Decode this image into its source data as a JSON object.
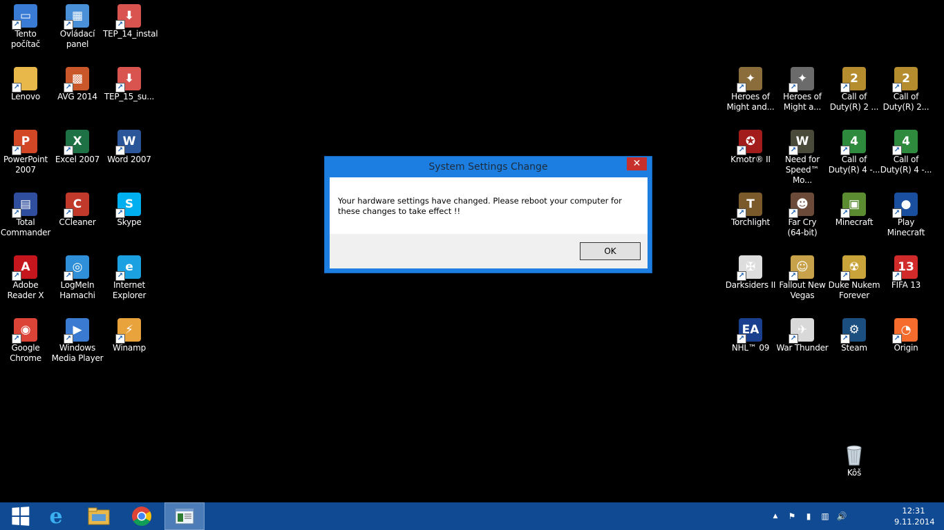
{
  "desktop": {
    "left_icons": [
      {
        "label": "Tento\npočítač",
        "icon": "computer-icon",
        "color": "#3a7bd5",
        "glyph": "▭"
      },
      {
        "label": "Ovládací\npanel",
        "icon": "control-panel-icon",
        "color": "#4a90d9",
        "glyph": "▦"
      },
      {
        "label": "TEP_14_instal",
        "icon": "installer-icon",
        "color": "#d9534f",
        "glyph": "⬇"
      },
      {
        "label": "Lenovo",
        "icon": "folder-icon",
        "color": "#e8b84a",
        "glyph": ""
      },
      {
        "label": "AVG 2014",
        "icon": "avg-icon",
        "color": "#c9572a",
        "glyph": "▩"
      },
      {
        "label": "TEP_15_su...",
        "icon": "installer-icon",
        "color": "#d9534f",
        "glyph": "⬇"
      },
      {
        "label": "PowerPoint\n2007",
        "icon": "powerpoint-icon",
        "color": "#d24726",
        "glyph": "P"
      },
      {
        "label": "Excel 2007",
        "icon": "excel-icon",
        "color": "#1e7145",
        "glyph": "X"
      },
      {
        "label": "Word 2007",
        "icon": "word-icon",
        "color": "#2b579a",
        "glyph": "W"
      },
      {
        "label": "Total\nCommander",
        "icon": "total-commander-icon",
        "color": "#2f4f9e",
        "glyph": "▤"
      },
      {
        "label": "CCleaner",
        "icon": "ccleaner-icon",
        "color": "#c0392b",
        "glyph": "C"
      },
      {
        "label": "Skype",
        "icon": "skype-icon",
        "color": "#00aff0",
        "glyph": "S"
      },
      {
        "label": "Adobe\nReader X",
        "icon": "adobe-reader-icon",
        "color": "#c4161c",
        "glyph": "A"
      },
      {
        "label": "LogMeIn\nHamachi",
        "icon": "hamachi-icon",
        "color": "#2f8fd8",
        "glyph": "◎"
      },
      {
        "label": "Internet\nExplorer",
        "icon": "internet-explorer-icon",
        "color": "#1ba1e2",
        "glyph": "e"
      },
      {
        "label": "Google\nChrome",
        "icon": "chrome-icon",
        "color": "#db4437",
        "glyph": "◉"
      },
      {
        "label": "Windows\nMedia Player",
        "icon": "media-player-icon",
        "color": "#3a7ad1",
        "glyph": "▶"
      },
      {
        "label": "Winamp",
        "icon": "winamp-icon",
        "color": "#e8a33d",
        "glyph": "⚡"
      }
    ],
    "right_icons": [
      {
        "label": "Heroes of\nMight and...",
        "icon": "heroes-icon",
        "color": "#8a6d3b",
        "glyph": "✦"
      },
      {
        "label": "Heroes of\nMight a...",
        "icon": "heroes-icon",
        "color": "#6b6b6b",
        "glyph": "✦"
      },
      {
        "label": "Call of\nDuty(R) 2 ...",
        "icon": "call-of-duty-icon",
        "color": "#b58d2f",
        "glyph": "2"
      },
      {
        "label": "Call of\nDuty(R) 2...",
        "icon": "call-of-duty-icon",
        "color": "#b58d2f",
        "glyph": "2"
      },
      {
        "label": "Kmotr® II",
        "icon": "kmotr-icon",
        "color": "#a31c1c",
        "glyph": "✪"
      },
      {
        "label": "Need for\nSpeed™ Mo...",
        "icon": "nfs-icon",
        "color": "#4a4a3a",
        "glyph": "W"
      },
      {
        "label": "Call of\nDuty(R) 4 -...",
        "icon": "call-of-duty-icon",
        "color": "#2e8b3d",
        "glyph": "4"
      },
      {
        "label": "Call of\nDuty(R) 4 -...",
        "icon": "call-of-duty-icon",
        "color": "#2e8b3d",
        "glyph": "4"
      },
      {
        "label": "Torchlight",
        "icon": "torchlight-icon",
        "color": "#7a5a2a",
        "glyph": "T"
      },
      {
        "label": "Far Cry\n(64-bit)",
        "icon": "far-cry-icon",
        "color": "#6b4a3a",
        "glyph": "☻"
      },
      {
        "label": "Minecraft",
        "icon": "minecraft-icon",
        "color": "#5b8c32",
        "glyph": "▣"
      },
      {
        "label": "Play\nMinecraft",
        "icon": "play-minecraft-icon",
        "color": "#1a4fa0",
        "glyph": "●"
      },
      {
        "label": "Darksiders II",
        "icon": "darksiders-icon",
        "color": "#dddddd",
        "glyph": "✠"
      },
      {
        "label": "Fallout New\nVegas",
        "icon": "fallout-icon",
        "color": "#c8a24a",
        "glyph": "☺"
      },
      {
        "label": "Duke Nukem\nForever",
        "icon": "duke-nukem-icon",
        "color": "#c9a43a",
        "glyph": "☢"
      },
      {
        "label": "FIFA 13",
        "icon": "fifa-icon",
        "color": "#d02a2a",
        "glyph": "13"
      },
      {
        "label": "NHL™ 09",
        "icon": "nhl-icon",
        "color": "#1a3f8f",
        "glyph": "EA"
      },
      {
        "label": "War Thunder",
        "icon": "war-thunder-icon",
        "color": "#d9d9d9",
        "glyph": "✈"
      },
      {
        "label": "Steam",
        "icon": "steam-icon",
        "color": "#1b4f80",
        "glyph": "⚙"
      },
      {
        "label": "Origin",
        "icon": "origin-icon",
        "color": "#f56c2d",
        "glyph": "◔"
      }
    ],
    "recycle_bin": {
      "label": "Kôš",
      "icon": "recycle-bin-icon",
      "color": "#9aa7b3"
    }
  },
  "dialog": {
    "title": "System Settings Change",
    "close_glyph": "✕",
    "message": "Your hardware settings have changed. Please reboot your computer for these changes to take effect !!",
    "ok_label": "OK"
  },
  "taskbar": {
    "pinned": [
      {
        "name": "start-button",
        "icon": "windows-logo-icon"
      },
      {
        "name": "taskbar-internet-explorer",
        "icon": "internet-explorer-icon",
        "glyph": "e",
        "color": "#1ba1e2"
      },
      {
        "name": "taskbar-file-explorer",
        "icon": "file-explorer-icon",
        "glyph": "▆",
        "color": "#e8b84a"
      },
      {
        "name": "taskbar-chrome",
        "icon": "chrome-icon",
        "glyph": "◉",
        "color": "#db4437"
      },
      {
        "name": "taskbar-active-window",
        "icon": "window-app-icon",
        "glyph": "▤",
        "color": "#d9e7f5"
      }
    ],
    "tray": {
      "show_hidden_glyph": "▲",
      "flag_glyph": "⚑",
      "power_glyph": "▮",
      "network_glyph": "▥",
      "volume_glyph": "🔊"
    },
    "clock": {
      "time": "12:31",
      "date": "9.11.2014"
    }
  }
}
